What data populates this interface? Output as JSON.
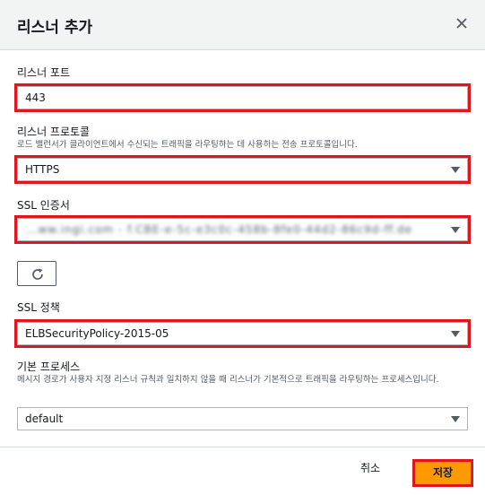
{
  "dialog": {
    "title": "리스너 추가",
    "close_icon": "close-icon"
  },
  "port": {
    "label": "리스너 포트",
    "value": "443"
  },
  "protocol": {
    "label": "리스너 프로토콜",
    "description": "로드 밸런서가 클라이언트에서 수신되는 트래픽을 라우팅하는 데 사용하는 전송 프로토콜입니다.",
    "value": "HTTPS"
  },
  "certificate": {
    "label": "SSL 인증서",
    "value": "...ww.ingi.com - f.CBE-e-5c-e3c0c-458b-8fe0-44d2-86c9d-ff.de",
    "refresh_icon": "refresh-icon"
  },
  "policy": {
    "label": "SSL 정책",
    "value": "ELBSecurityPolicy-2015-05"
  },
  "default_process": {
    "label": "기본 프로세스",
    "description": "메시지 경로가 사용자 지정 리스너 규칙과 일치하지 않을 때 리스너가 기본적으로 트래픽을 라우팅하는 프로세스입니다.",
    "value": "default"
  },
  "footer": {
    "cancel_label": "취소",
    "save_label": "저장"
  },
  "colors": {
    "highlight": "#e0161f",
    "primary_button": "#ff9900",
    "header_bg": "#f2f3f3"
  }
}
